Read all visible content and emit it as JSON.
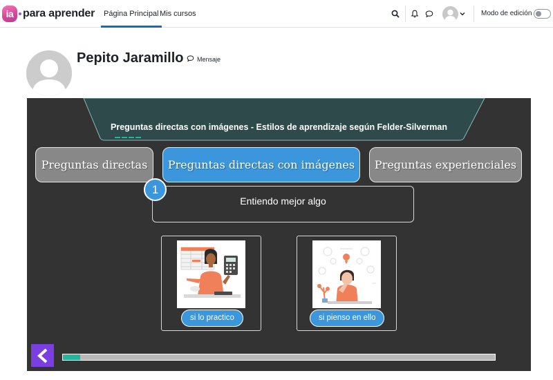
{
  "brand": {
    "badge": "ia",
    "name": "para aprender",
    "badge_color": "#d9479b"
  },
  "nav": {
    "links": [
      {
        "label": "Página Principal",
        "active": true
      },
      {
        "label": "Mis cursos",
        "active": false
      }
    ],
    "icons": [
      "search-icon",
      "bell-icon",
      "chat-icon",
      "user-avatar",
      "chevron-down-icon"
    ],
    "edit_mode_label": "Modo de edición",
    "edit_mode_on": false
  },
  "profile": {
    "name": "Pepito Jaramillo",
    "message_label": "Mensaje"
  },
  "activity": {
    "title": "Preguntas directas con imágenes - Estilos de aprendizaje según Felder-Silverman",
    "tabs": [
      {
        "label": "Preguntas directas",
        "selected": false
      },
      {
        "label": "Preguntas directas con imágenes",
        "selected": true
      },
      {
        "label": "Preguntas experienciales",
        "selected": false
      }
    ],
    "question_number": "1",
    "question_text": "Entiendo mejor algo",
    "options": [
      {
        "label": "si lo practico",
        "image": "woman-working-with-calculator-illustration"
      },
      {
        "label": "si pienso en ello",
        "image": "man-thinking-illustration"
      }
    ],
    "progress_fraction": 0.04,
    "colors": {
      "accent_blue": "#3c96db",
      "tab_gray": "#888888",
      "stage_bg": "#333333",
      "progress_green": "#25b59a",
      "back_purple": "#7a3fe0"
    }
  }
}
